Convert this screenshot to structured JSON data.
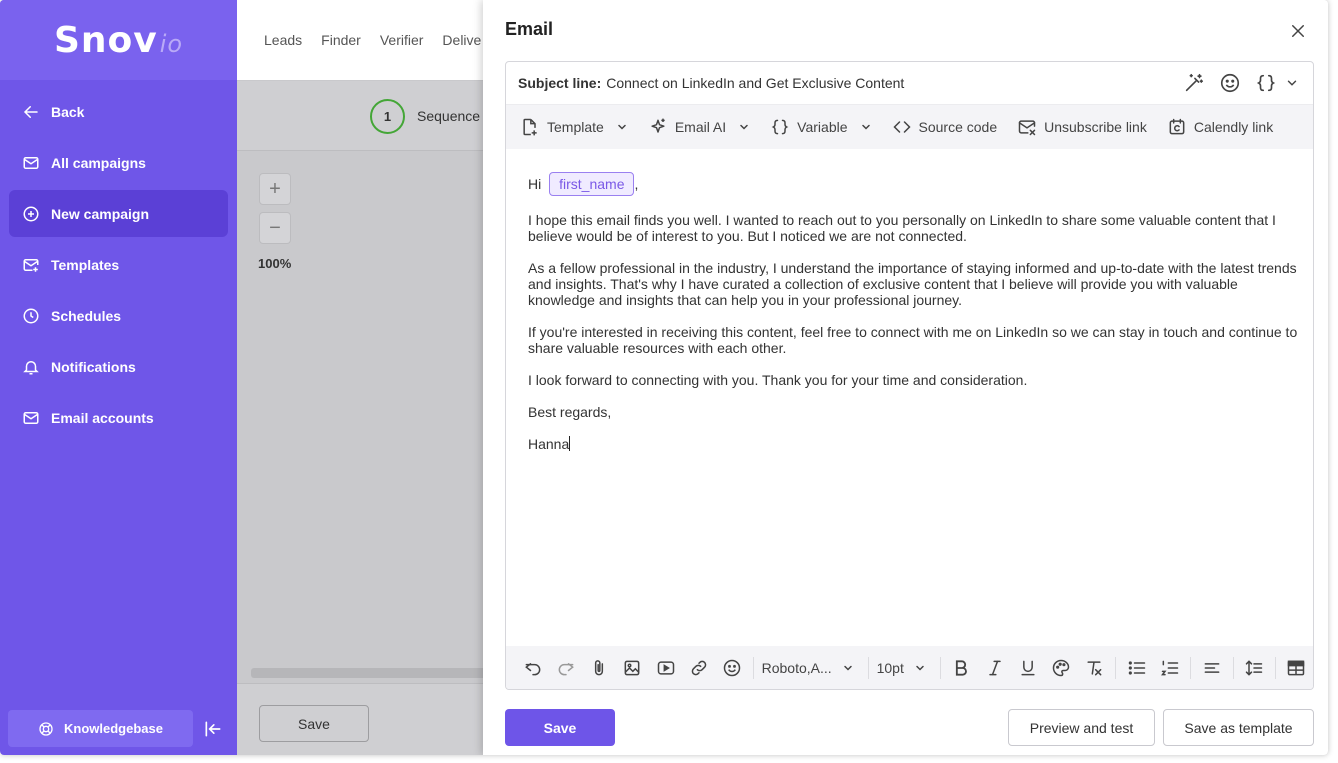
{
  "brand": {
    "logo_main": "Snov",
    "logo_suffix": "io"
  },
  "sidebar": {
    "items": [
      {
        "label": "Back"
      },
      {
        "label": "All campaigns"
      },
      {
        "label": "New campaign"
      },
      {
        "label": "Templates"
      },
      {
        "label": "Schedules"
      },
      {
        "label": "Notifications"
      },
      {
        "label": "Email accounts"
      }
    ],
    "active_index": 2,
    "knowledgebase_label": "Knowledgebase"
  },
  "topnav": {
    "items": [
      "Leads",
      "Finder",
      "Verifier",
      "Delive"
    ]
  },
  "steps": {
    "step_number": "1",
    "step_label": "Sequence"
  },
  "zoom": {
    "plus": "+",
    "minus": "−",
    "level": "100%"
  },
  "background": {
    "save_label": "Save"
  },
  "modal": {
    "title": "Email",
    "subject_label": "Subject line:",
    "subject_value": "Connect on LinkedIn and Get Exclusive Content",
    "toolbar": {
      "template": "Template",
      "email_ai": "Email AI",
      "variable": "Variable",
      "source_code": "Source code",
      "unsubscribe": "Unsubscribe link",
      "calendly": "Calendly link"
    },
    "body": {
      "greeting": "Hi",
      "variable_chip": "first_name",
      "greeting_punct": ",",
      "p1": "I hope this email finds you well. I wanted to reach out to you personally on LinkedIn to share some valuable content that I believe would be of interest to you. But I noticed we are not connected.",
      "p2": "As a fellow professional in the industry, I understand the importance of staying informed and up-to-date with the latest trends and insights. That's why I have curated a collection of exclusive content that I believe will provide you with valuable knowledge and insights that can help you in your professional journey.",
      "p3": "If you're interested in receiving this content,  feel free to connect with me on LinkedIn so we can stay in touch and continue to share valuable resources with each other.",
      "p4": "I look forward to connecting with you. Thank you for your time and consideration.",
      "p5": "Best regards,",
      "p6": "Hanna"
    },
    "format": {
      "font": "Roboto,A...",
      "size": "10pt"
    },
    "buttons": {
      "save": "Save",
      "preview": "Preview and test",
      "save_template": "Save as template"
    }
  },
  "colors": {
    "sidebar": "#6f56e8",
    "accent": "#6e55e8",
    "variable_chip": "#7a58e6",
    "step_ring": "#44a637"
  }
}
